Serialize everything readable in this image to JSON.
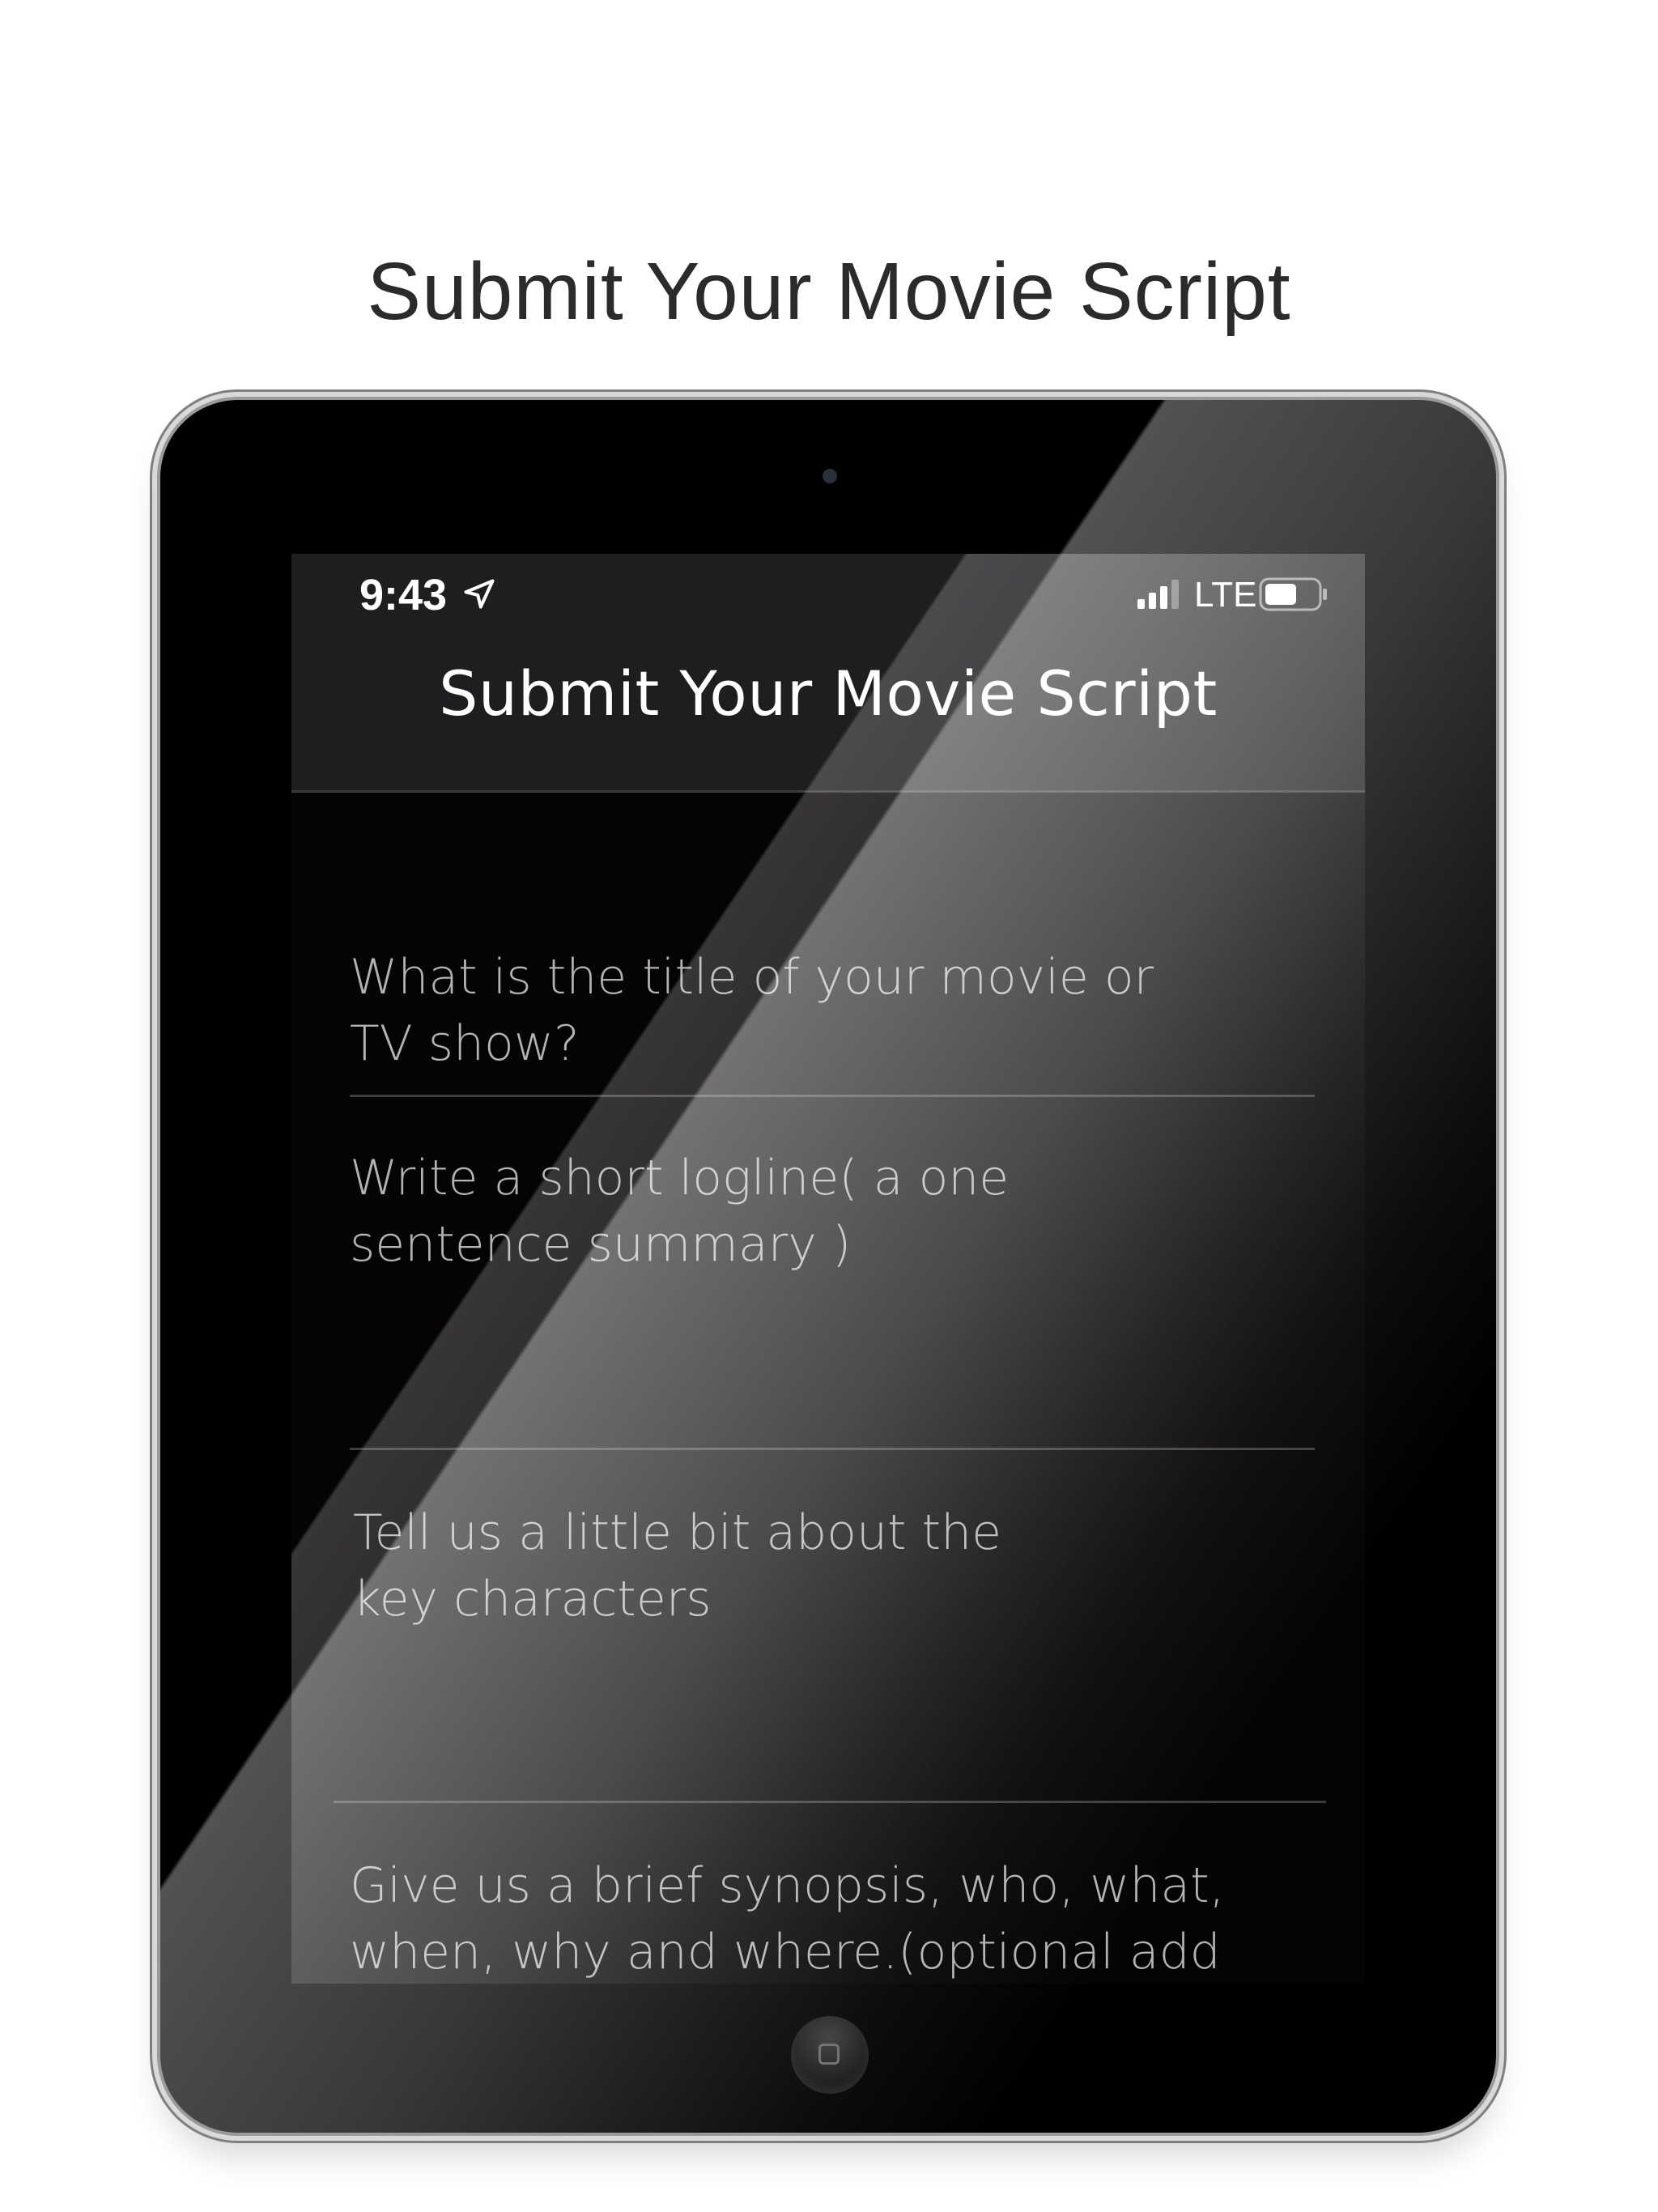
{
  "promo": {
    "title": "Submit Your Movie Script"
  },
  "status_bar": {
    "time": "9:43",
    "network": "LTE",
    "icons": [
      "location-arrow-icon",
      "signal-bars-icon",
      "battery-icon"
    ]
  },
  "nav": {
    "title": "Submit Your Movie Script"
  },
  "form": {
    "fields": [
      {
        "placeholder": "What is the title of your movie or\nTV show?"
      },
      {
        "placeholder": "Write a short logline( a one\nsentence summary )"
      },
      {
        "placeholder": "Tell us a little bit about the\nkey characters"
      },
      {
        "placeholder": "Give us a brief synopsis, who, what,\nwhen, why and where.(optional add"
      }
    ]
  },
  "colors": {
    "nav_background": "#1e1d1f",
    "screen_background": "#050304",
    "placeholder_text": "#b3b3b3",
    "divider": "#3d3c3e",
    "promo_title": "#2b2b2b"
  }
}
